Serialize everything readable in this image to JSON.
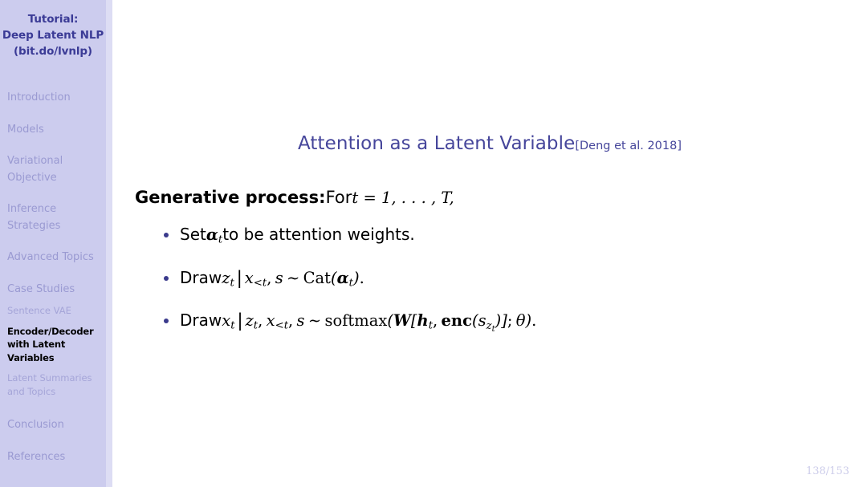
{
  "sidebar": {
    "title_lines": [
      "Tutorial:",
      "Deep Latent NLP",
      "(bit.do/lvnlp)"
    ],
    "sections": [
      {
        "label": "Introduction"
      },
      {
        "label": "Models"
      },
      {
        "label": "Variational Objective"
      },
      {
        "label": "Inference Strategies"
      },
      {
        "label": "Advanced Topics"
      },
      {
        "label": "Case Studies"
      },
      {
        "label": "Conclusion"
      },
      {
        "label": "References"
      }
    ],
    "subsections": [
      {
        "label": "Sentence VAE",
        "active": false
      },
      {
        "label": "Encoder/Decoder with Latent Variables",
        "active": true
      },
      {
        "label": "Latent Summaries and Topics",
        "active": false
      }
    ],
    "colors": {
      "background": "#ccccee",
      "gutter": "#ddddf4",
      "title_text": "#3b3b96",
      "section_text": "#9a9ad2",
      "active_text": "#000000"
    }
  },
  "slide": {
    "title": "Attention as a Latent Variable",
    "citation": "[Deng et al. 2018]",
    "lead_bold": "Generative process:",
    "lead_rest": "For",
    "lead_math": "t = 1, . . . , T,",
    "bullets": [
      {
        "text_before": "Set",
        "math": "α_t",
        "text_after": "to be attention weights."
      },
      {
        "text_before": "Draw",
        "math": "z_t | x_{<t}, s ~ Cat(α_t).",
        "text_after": ""
      },
      {
        "text_before": "Draw",
        "math": "x_t | z_t, x_{<t}, s ~ softmax(W[h_t, enc(s_{z_t})]; θ).",
        "text_after": ""
      }
    ],
    "page_number": "138/153",
    "colors": {
      "title": "#46469b",
      "bullet_marker": "#3a3a8c",
      "body_text": "#000000",
      "page_number": "#ccccea"
    }
  }
}
